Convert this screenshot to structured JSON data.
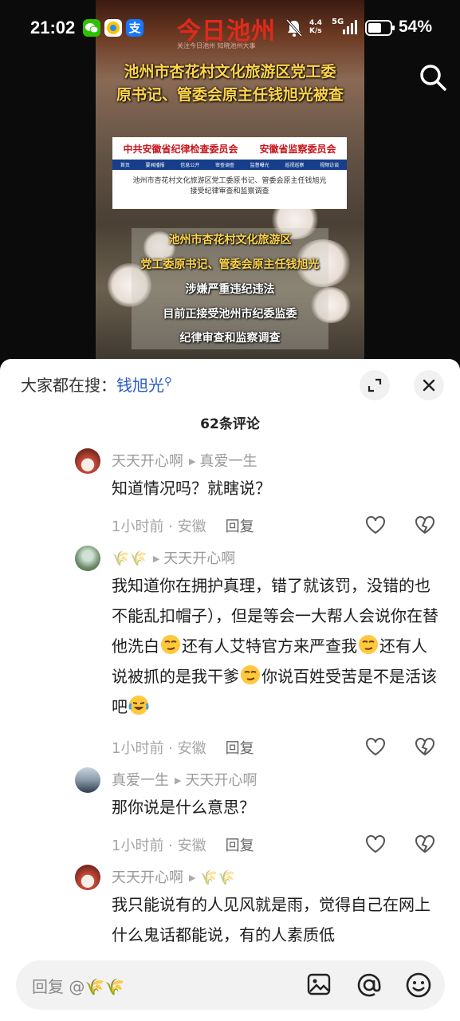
{
  "status_bar": {
    "time": "21:02",
    "network_speed": "4.4\nK/s",
    "signal": "5G",
    "battery": "54%"
  },
  "video": {
    "brand": "今日池州",
    "brand_sub": "关注今日池州 知晓池州大事",
    "headline_line1": "池州市杏花村文化旅游区党工委",
    "headline_line2": "原书记、管委会原主任钱旭光被查",
    "card": {
      "org1": "中共安徽省纪律检查委员会",
      "org2": "安徽省监察委员会",
      "nav": [
        "首页",
        "要闻播报",
        "信息公开",
        "审查调查",
        "监督曝光",
        "巡视巡察",
        "视频访谈"
      ],
      "text": "池州市杏花村文化旅游区党工委原书记、管委会原主任钱旭光接受纪律审查和监察调查"
    },
    "overlay_lines": [
      "池州市杏花村文化旅游区",
      "党工委原书记、管委会原主任钱旭光",
      "涉嫌严重违纪违法",
      "目前正接受池州市纪委监委",
      "纪律审查和监察调查"
    ]
  },
  "sheet": {
    "search_prefix": "大家都在搜：",
    "search_term": "钱旭光",
    "comment_count": "62条评论",
    "comments": [
      {
        "author": "天天开心啊",
        "reply_to": "真爱一生",
        "text": "知道情况吗？就瞎说？",
        "time": "1小时前 · 安徽",
        "reply_label": "回复"
      },
      {
        "author": "🌾🌾",
        "reply_to": "天天开心啊",
        "text_parts": [
          "我知道你在拥护真理，错了就该罚，没错的也不能乱扣帽子），但是等会一大帮人会说你在替他洗白",
          "还有人艾特官方来严查我",
          "还有人说被抓的是我干爹",
          "你说百姓受苦是不是活该吧"
        ],
        "time": "1小时前 · 安徽",
        "reply_label": "回复"
      },
      {
        "author": "真爱一生",
        "reply_to": "天天开心啊",
        "text": "那你说是什么意思？",
        "time": "1小时前 · 安徽",
        "reply_label": "回复"
      },
      {
        "author": "天天开心啊",
        "reply_to": "🌾🌾",
        "text": "我只能说有的人见风就是雨，觉得自己在网上什么鬼话都能说，有的人素质低"
      }
    ],
    "input_placeholder": "回复 @🌾🌾"
  }
}
